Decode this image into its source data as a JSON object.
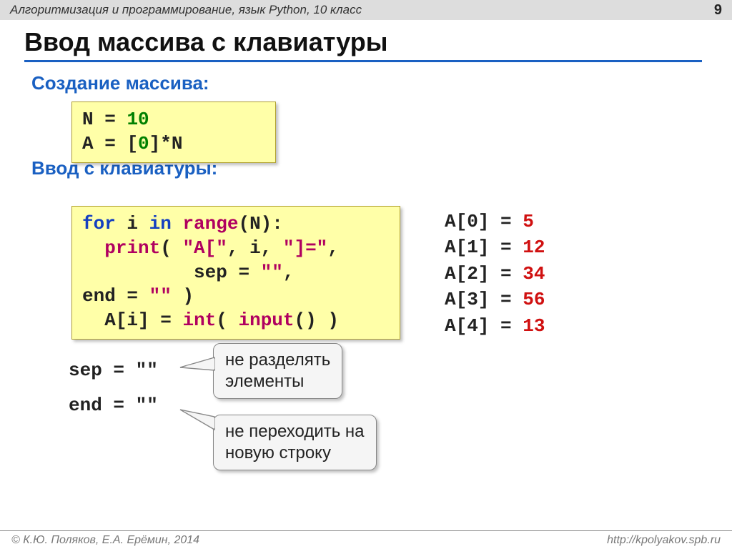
{
  "header": {
    "breadcrumb": "Алгоритмизация и программирование, язык Python, 10 класс",
    "page": "9"
  },
  "title": "Ввод массива с клавиатуры",
  "section1_h": "Создание массива:",
  "code1": {
    "l1a": "N",
    "l1b": "=",
    "l1c": "10",
    "l2a": "A",
    "l2b": "=",
    "l2c": "[",
    "l2d": "0",
    "l2e": "]*N"
  },
  "section2_h": "Ввод с клавиатуры:",
  "code2": {
    "l1a": "for",
    "l1b": " i ",
    "l1c": "in",
    "l1d": " ",
    "l1e": "range",
    "l1f": "(N):",
    "l2a": "print",
    "l2b": "(",
    "l2c": " \"A[\"",
    "l2d": ", i, ",
    "l2e": "\"]=\"",
    "l2f": ",",
    "l3a": "sep",
    "l3b": "=",
    "l3c": "\"\"",
    "l3d": ", end",
    "l3e": "=",
    "l3f": "\"\"",
    "l3g": " )",
    "l4a": "A[i]",
    "l4b": "=",
    "l4c": "int",
    "l4d": "(",
    "l4e": " input",
    "l4f": "() )"
  },
  "output": [
    {
      "lbl": "A[0] =",
      "val": " 5"
    },
    {
      "lbl": "A[1] =",
      "val": " 12"
    },
    {
      "lbl": "A[2] =",
      "val": " 34"
    },
    {
      "lbl": "A[3] =",
      "val": " 56"
    },
    {
      "lbl": "A[4] =",
      "val": " 13"
    }
  ],
  "params": {
    "p1a": "sep",
    "p1b": "=",
    "p1c": "\"\"",
    "p2a": "end",
    "p2b": "=",
    "p2c": "\"\""
  },
  "callout1": "не разделять\nэлементы",
  "callout2": "не переходить на\nновую строку",
  "footer": {
    "left": "© К.Ю. Поляков, Е.А. Ерёмин, 2014",
    "right": "http://kpolyakov.spb.ru"
  }
}
